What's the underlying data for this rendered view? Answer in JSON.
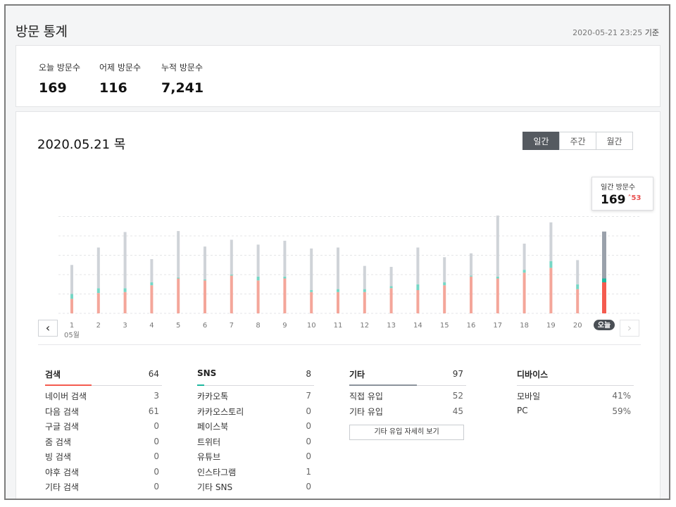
{
  "header": {
    "title": "방문 통계",
    "updated_at": "2020-05-21 23:25",
    "updated_suffix": "기준"
  },
  "summary": [
    {
      "label": "오늘 방문수",
      "value": "169"
    },
    {
      "label": "어제 방문수",
      "value": "116"
    },
    {
      "label": "누적 방문수",
      "value": "7,241"
    }
  ],
  "main": {
    "date_title": "2020.05.21 목",
    "tabs": [
      {
        "label": "일간",
        "active": true
      },
      {
        "label": "주간",
        "active": false
      },
      {
        "label": "월간",
        "active": false
      }
    ],
    "month_label": "05월"
  },
  "tooltip": {
    "label": "일간 방문수",
    "value": "169",
    "delta": "53"
  },
  "chart_data": {
    "type": "bar",
    "categories": [
      "1",
      "2",
      "3",
      "4",
      "5",
      "6",
      "7",
      "8",
      "9",
      "10",
      "11",
      "12",
      "13",
      "14",
      "15",
      "16",
      "17",
      "18",
      "19",
      "20",
      "오늘"
    ],
    "stacked": true,
    "series": [
      {
        "name": "검색",
        "color": "#f4a69a",
        "values": [
          30,
          42,
          44,
          58,
          72,
          68,
          78,
          68,
          72,
          44,
          44,
          44,
          52,
          48,
          58,
          76,
          72,
          84,
          94,
          50,
          64
        ]
      },
      {
        "name": "SNS",
        "color": "#76d7c6",
        "values": [
          10,
          10,
          8,
          6,
          2,
          2,
          2,
          8,
          4,
          4,
          6,
          6,
          4,
          12,
          6,
          2,
          4,
          6,
          14,
          10,
          8
        ]
      },
      {
        "name": "기타",
        "color": "#cfd3d8",
        "values": [
          60,
          84,
          116,
          48,
          96,
          68,
          72,
          66,
          74,
          86,
          86,
          48,
          40,
          76,
          52,
          46,
          126,
          54,
          80,
          50,
          97
        ]
      }
    ],
    "today_colors": {
      "검색": "#f45b4f",
      "SNS": "#1fb89f",
      "기타": "#9aa1ab"
    },
    "grid": true,
    "legend": "none"
  },
  "breakdown": [
    {
      "title": "검색",
      "total": "64",
      "accent": "#f45b4f",
      "rows": [
        {
          "label": "네이버 검색",
          "value": "3"
        },
        {
          "label": "다음 검색",
          "value": "61"
        },
        {
          "label": "구글 검색",
          "value": "0"
        },
        {
          "label": "줌 검색",
          "value": "0"
        },
        {
          "label": "빙 검색",
          "value": "0"
        },
        {
          "label": "야후 검색",
          "value": "0"
        },
        {
          "label": "기타 검색",
          "value": "0"
        }
      ]
    },
    {
      "title": "SNS",
      "total": "8",
      "accent": "#1fb89f",
      "rows": [
        {
          "label": "카카오톡",
          "value": "7"
        },
        {
          "label": "카카오스토리",
          "value": "0"
        },
        {
          "label": "페이스북",
          "value": "0"
        },
        {
          "label": "트위터",
          "value": "0"
        },
        {
          "label": "유튜브",
          "value": "0"
        },
        {
          "label": "인스타그램",
          "value": "1"
        },
        {
          "label": "기타 SNS",
          "value": "0"
        }
      ]
    },
    {
      "title": "기타",
      "total": "97",
      "accent": "#8c939c",
      "rows": [
        {
          "label": "직접 유입",
          "value": "52"
        },
        {
          "label": "기타 유입",
          "value": "45"
        }
      ],
      "more_button": "기타 유입 자세히 보기"
    },
    {
      "title": "디바이스",
      "total": "",
      "rows": [
        {
          "label": "모바일",
          "value": "41%"
        },
        {
          "label": "PC",
          "value": "59%"
        }
      ]
    }
  ]
}
